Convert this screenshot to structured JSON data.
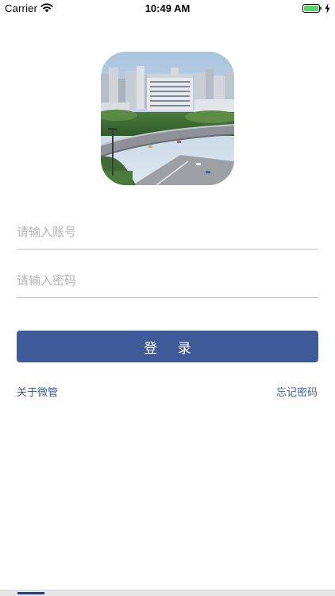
{
  "status_bar": {
    "carrier": "Carrier",
    "time": "10:49 AM",
    "battery_icon": "battery-full-icon",
    "battery_color": "#4cd964",
    "wifi_icon": "wifi-icon",
    "charging_icon": "charging-bolt-icon"
  },
  "logo": {
    "icon": "city-building-logo"
  },
  "login_form": {
    "account_placeholder": "请输入账号",
    "password_placeholder": "请输入密码",
    "login_label": "登 录",
    "accent_color": "#3f5a98"
  },
  "links": {
    "about_label": "关于微管",
    "forgot_label": "忘记密码"
  }
}
